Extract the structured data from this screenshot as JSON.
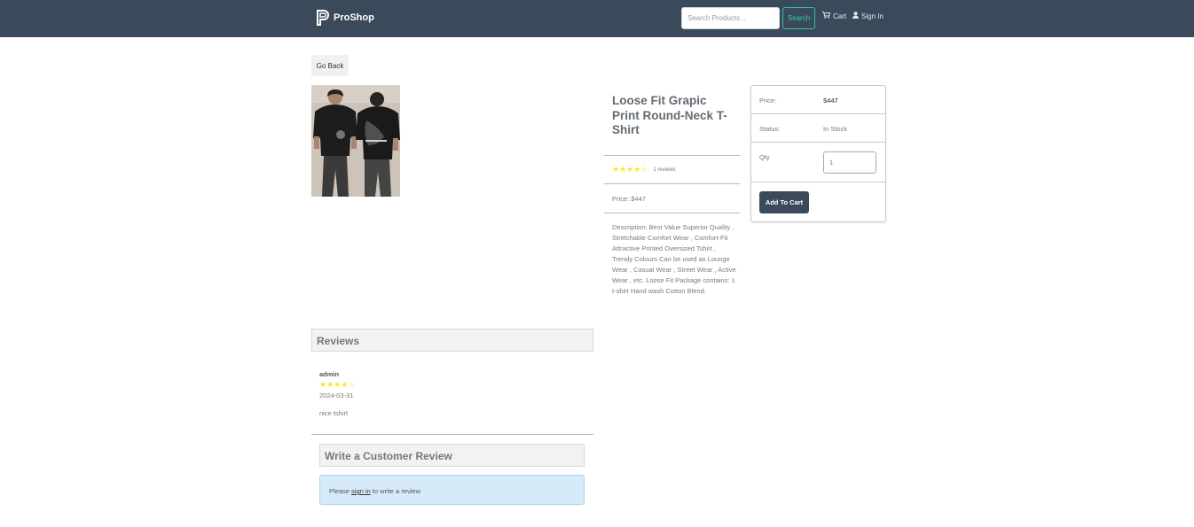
{
  "header": {
    "brand": "ProShop",
    "search_placeholder": "Search Products...",
    "search_button": "Search",
    "cart_label": "Cart",
    "signin_label": "Sign In",
    "bar_color": "#3a4a5b",
    "accent_color": "#2fd1a8"
  },
  "page": {
    "go_back_label": "Go Back"
  },
  "product": {
    "title": "Loose Fit Grapic Print Round-Neck T-Shirt",
    "rating": 3.5,
    "rating_stars": "★★★★☆",
    "reviews_text": "1 reviews",
    "price_line": "Price: $447",
    "description": "Description: Best Value Superior Quality , Stretchable Comfort Wear , Comfort-Fit Attractive Printed Oversized Tshirt , Trendy Colours Can be used as Lounge Wear , Casual Wear , Street Wear , Active Wear , etc. Loose Fit Package contains: 1 t-shirt Hand wash Cotton Blend.",
    "image_icon": "tshirt-photo"
  },
  "purchase_card": {
    "price_label": "Price:",
    "price_value": "$447",
    "status_label": "Status:",
    "status_value": "In Stock",
    "qty_label": "Qty",
    "qty_value": "1",
    "add_to_cart": "Add To Cart"
  },
  "reviews": {
    "heading": "Reviews",
    "items": [
      {
        "name": "admin",
        "rating": 3.5,
        "stars": "★★★★☆",
        "date": "2024-03-31",
        "comment": "nice tshirt"
      }
    ],
    "write_heading": "Write a Customer Review",
    "alert_prefix": "Please ",
    "alert_link": "sign in",
    "alert_suffix": " to write a review"
  }
}
